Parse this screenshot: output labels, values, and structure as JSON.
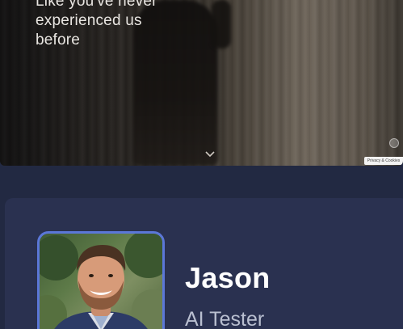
{
  "hero": {
    "headline_lines": [
      "Like you've never",
      "experienced us",
      "before"
    ],
    "scroll_icon": "chevron-down-icon",
    "side_control_icon": "circle-dot-icon",
    "chip_label": "Privacy & Cookies"
  },
  "profile": {
    "name": "Jason",
    "role": "AI Tester",
    "photo_border_color": "#5b77d8"
  },
  "colors": {
    "page_background": "#222942",
    "card_background": "#2a3150",
    "accent": "#5b77d8"
  }
}
